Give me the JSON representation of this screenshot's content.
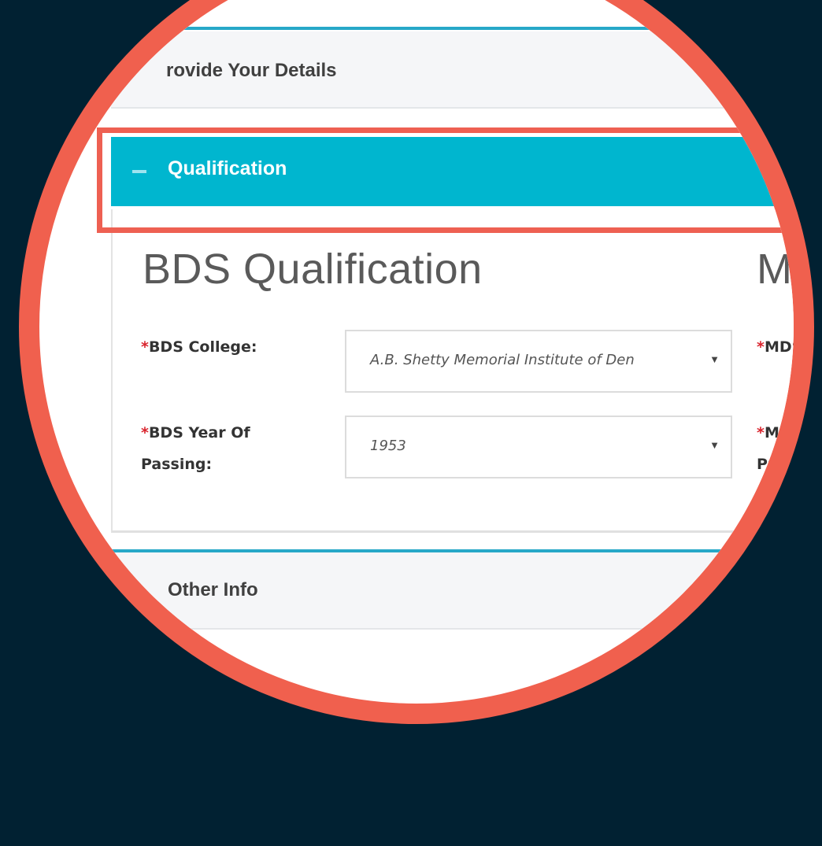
{
  "accordion": {
    "provide_details": "rovide Your Details",
    "qualification": "Qualification",
    "other_info": "Other Info"
  },
  "bds": {
    "section_title": "BDS Qualification",
    "college_label": "BDS College:",
    "college_value": "A.B. Shetty Memorial Institute of Den",
    "year_label_line1": "BDS Year Of",
    "year_label_line2": "Passing:",
    "year_value": "1953"
  },
  "mds": {
    "section_title": "MD",
    "college_label": "MDS C",
    "year_label_line1": "MDS",
    "year_label_line2": "Passi"
  },
  "required_marker": "*",
  "icons": {
    "collapse": "minus-icon",
    "expand": "plus-icon",
    "dropdown": "caret-down-icon"
  },
  "colors": {
    "background": "#012132",
    "accent": "#00b6cf",
    "highlight": "#f0604e",
    "required": "#d9232c"
  }
}
